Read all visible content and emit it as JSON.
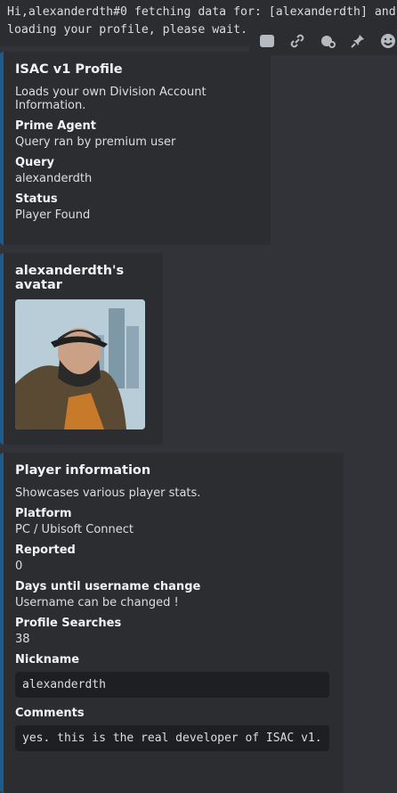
{
  "top_message": {
    "line1": "Hi,alexanderdth#0 fetching data for: [alexanderdth] and",
    "line2": "loading your profile, please wait..."
  },
  "toolbar": {
    "icons": [
      "id-icon",
      "link-icon",
      "reply-thread-icon",
      "pin-icon",
      "emoji-icon"
    ]
  },
  "embed1": {
    "title": "ISAC v1 Profile",
    "description": "Loads your own Division Account Information.",
    "fields": [
      {
        "name": "Prime Agent",
        "value": "Query ran by premium user"
      },
      {
        "name": "Query",
        "value": "alexanderdth"
      },
      {
        "name": "Status",
        "value": "Player Found"
      }
    ]
  },
  "embed2": {
    "title": "alexanderdth's avatar"
  },
  "embed3": {
    "title": "Player information",
    "description": "Showcases various player stats.",
    "fields": [
      {
        "name": "Platform",
        "value": "PC / Ubisoft Connect"
      },
      {
        "name": "Reported",
        "value": "0"
      },
      {
        "name": "Days until username change",
        "value": "Username can be changed !"
      },
      {
        "name": "Profile Searches",
        "value": "38"
      }
    ],
    "nickname_label": "Nickname",
    "nickname_value": "alexanderdth",
    "comments_label": "Comments",
    "comments_value": "yes. this is the real developer of ISAC v1."
  },
  "colors": {
    "embed_border": "#1e5b8c",
    "background": "#313338",
    "embed_bg": "#2b2d31"
  }
}
